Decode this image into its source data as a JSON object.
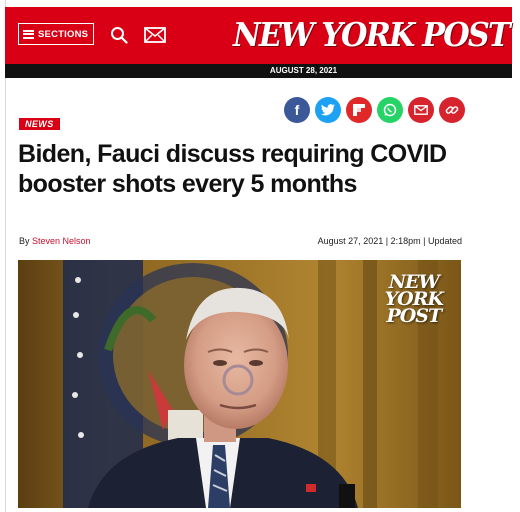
{
  "header": {
    "sections_label": "SECTIONS",
    "logo_text": "NEW YORK POST",
    "search_icon": "search-icon",
    "mail_icon": "mail-icon",
    "brand_color": "#d90015"
  },
  "date_bar": "AUGUST 28, 2021",
  "share_icons": [
    {
      "name": "facebook-icon",
      "color": "#3b5998"
    },
    {
      "name": "twitter-icon",
      "color": "#1da1f2"
    },
    {
      "name": "flipboard-icon",
      "color": "#e12828"
    },
    {
      "name": "whatsapp-icon",
      "color": "#25d366"
    },
    {
      "name": "email-share-icon",
      "color": "#d6232d"
    },
    {
      "name": "copy-link-icon",
      "color": "#d6232d"
    }
  ],
  "article": {
    "tag": "NEWS",
    "headline": "Biden, Fauci discuss requiring COVID booster shots every 5 months",
    "byline_prefix": "By",
    "author": "Steven Nelson",
    "date": "August 27, 2021",
    "time": "2:18pm",
    "updated_label": "Updated",
    "photo_watermark": [
      "NEW",
      "YORK",
      "POST"
    ]
  }
}
